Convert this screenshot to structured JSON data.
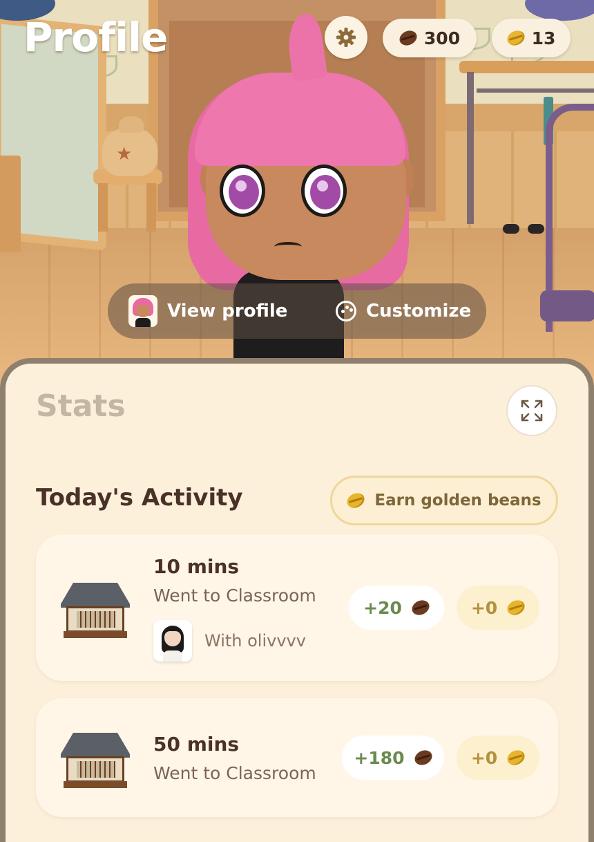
{
  "header": {
    "title": "Profile",
    "settings_icon": "gear-icon",
    "coffee_beans": "300",
    "golden_beans": "13"
  },
  "profile_actions": {
    "view_profile": "View profile",
    "customize": "Customize"
  },
  "stats": {
    "title": "Stats",
    "expand_icon": "expand-icon"
  },
  "activity": {
    "title": "Today's Activity",
    "earn_button": "Earn golden beans",
    "items": [
      {
        "duration": "10 mins",
        "place": "Went to Classroom",
        "with": "With olivvvv",
        "beans_reward": "+20",
        "golden_reward": "+0"
      },
      {
        "duration": "50 mins",
        "place": "Went to Classroom",
        "beans_reward": "+180",
        "golden_reward": "+0"
      }
    ]
  },
  "colors": {
    "sheet_background": "#fdf0db",
    "avatar_hair": "#e76aa3",
    "gold_accent": "#e6b52c",
    "coffee_bean": "#6b3a1f"
  }
}
